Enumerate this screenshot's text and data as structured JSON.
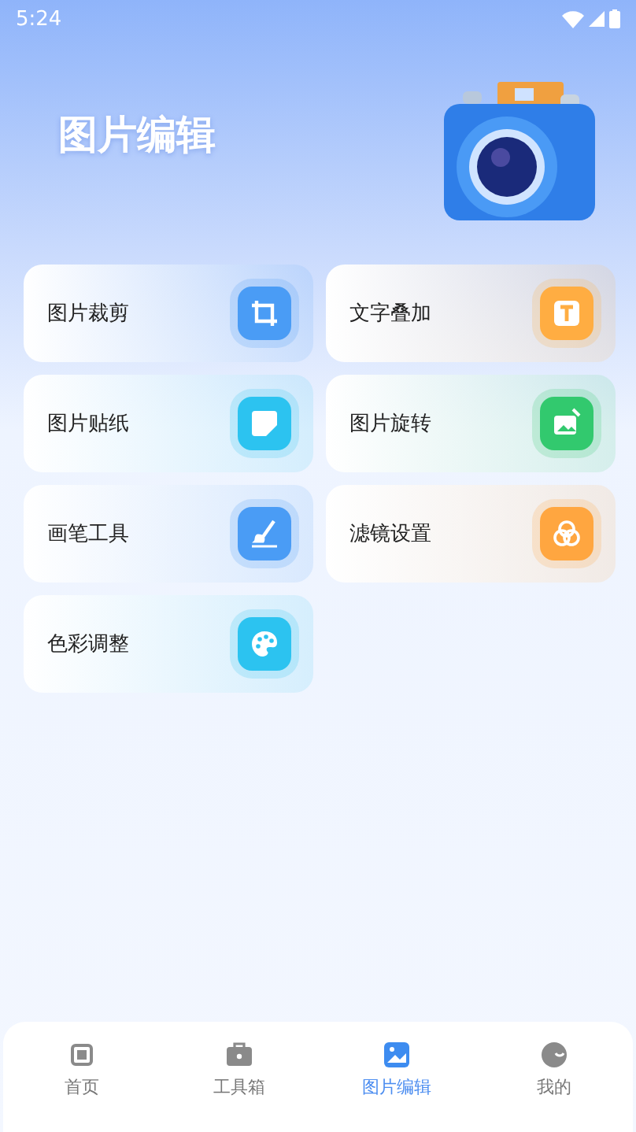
{
  "status_bar": {
    "time": "5:24"
  },
  "header": {
    "title": "图片编辑"
  },
  "tools": [
    {
      "label": "图片裁剪",
      "kind": "crop",
      "color": "#4a9cf5"
    },
    {
      "label": "文字叠加",
      "kind": "text",
      "color": "#ffad42"
    },
    {
      "label": "图片贴纸",
      "kind": "sticker",
      "color": "#2cc3f0"
    },
    {
      "label": "图片旋转",
      "kind": "rotate",
      "color": "#32c96e"
    },
    {
      "label": "画笔工具",
      "kind": "brush",
      "color": "#4a9cf5"
    },
    {
      "label": "滤镜设置",
      "kind": "filter",
      "color": "#ffa640"
    },
    {
      "label": "色彩调整",
      "kind": "palette",
      "color": "#2cc3f0"
    }
  ],
  "nav": [
    {
      "label": "首页",
      "kind": "home",
      "selected": false
    },
    {
      "label": "工具箱",
      "kind": "toolbox",
      "selected": false
    },
    {
      "label": "图片编辑",
      "kind": "image",
      "selected": true
    },
    {
      "label": "我的",
      "kind": "me",
      "selected": false
    }
  ]
}
